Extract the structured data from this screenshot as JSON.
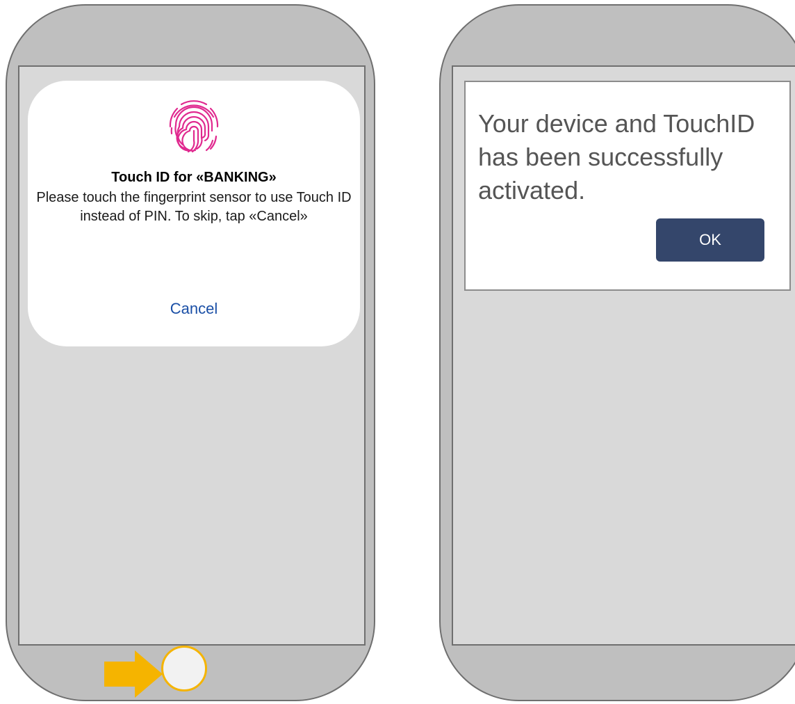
{
  "left_phone": {
    "alert": {
      "title": "Touch ID for «BANKING»",
      "message": "Please touch the fingerprint sensor to use Touch ID instead of PIN. To skip, tap «Cancel»",
      "cancel_label": "Cancel",
      "icon": "fingerprint-icon",
      "icon_color": "#e0298f"
    },
    "home_button": {
      "highlight_color": "#f5b400"
    },
    "arrow": {
      "icon": "arrow-right-icon",
      "color": "#f5b400"
    }
  },
  "right_phone": {
    "dialog": {
      "message": "Your device and TouchID has been successfully activated.",
      "ok_label": "OK",
      "ok_color": "#34466b"
    }
  }
}
